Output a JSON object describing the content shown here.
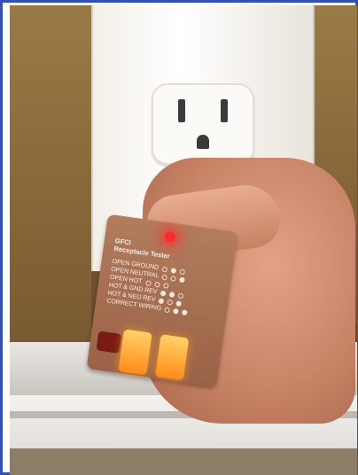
{
  "photo": {
    "tester": {
      "title_line1": "GFCI",
      "title_line2": "Receptacle Tester",
      "rows": [
        {
          "label": "OPEN GROUND"
        },
        {
          "label": "OPEN NEUTRAL"
        },
        {
          "label": "OPEN HOT"
        },
        {
          "label": "HOT & GND REV"
        },
        {
          "label": "HOT & NEU REV"
        },
        {
          "label": "CORRECT WIRING"
        }
      ]
    }
  }
}
